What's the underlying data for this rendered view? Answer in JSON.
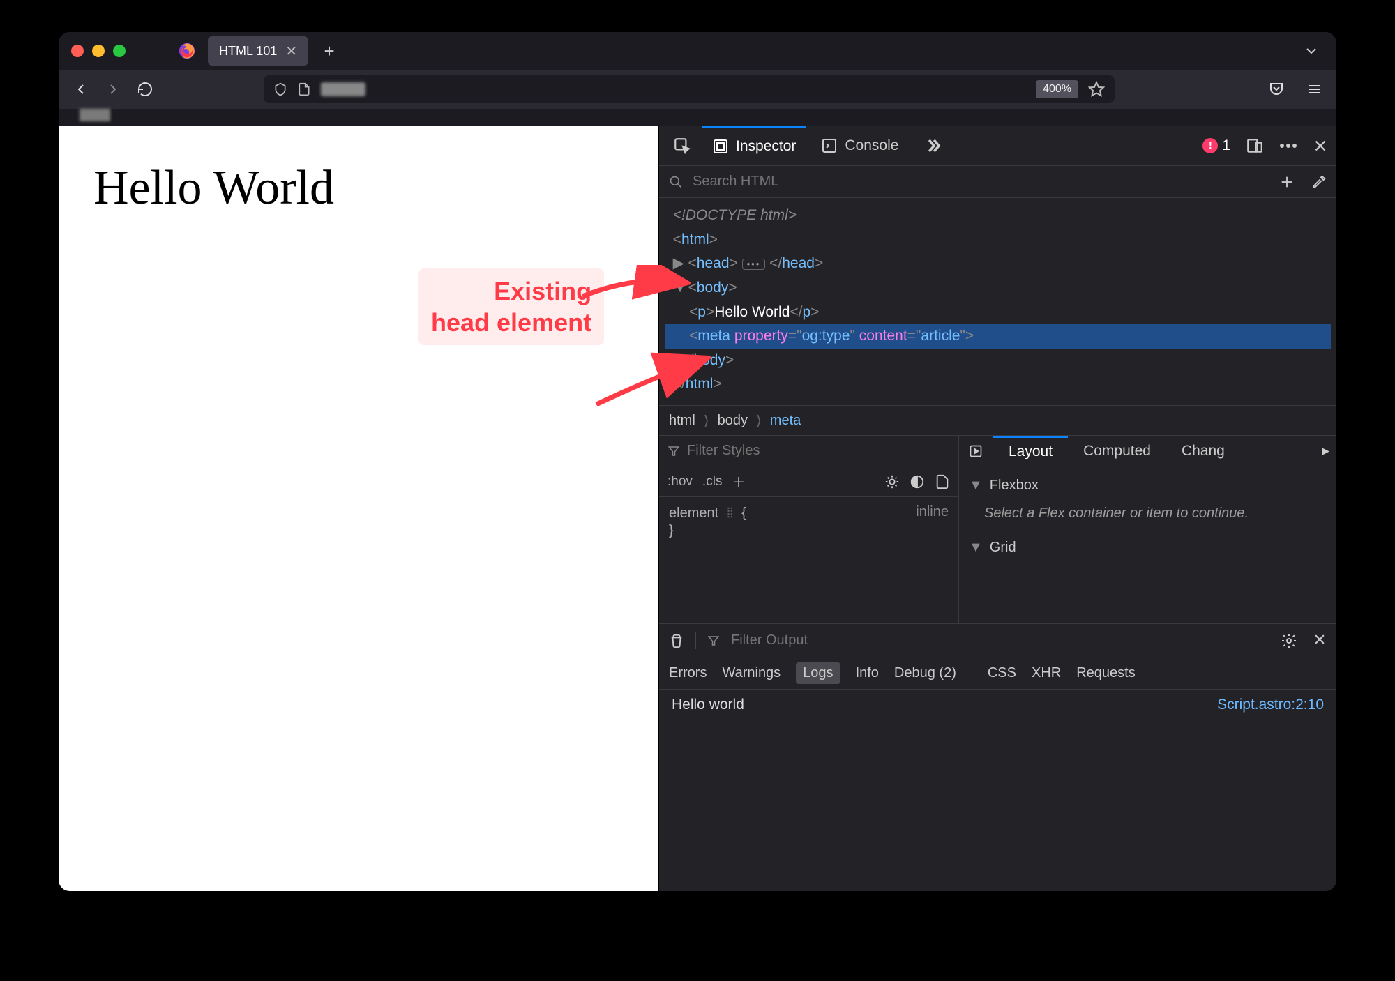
{
  "window": {
    "tab_title": "HTML 101",
    "zoom": "400%"
  },
  "page": {
    "heading": "Hello World"
  },
  "annotation": {
    "line1": "Existing",
    "line2": "head element"
  },
  "devtools": {
    "tabs": {
      "inspector": "Inspector",
      "console": "Console"
    },
    "errors_count": "1",
    "search_placeholder": "Search HTML",
    "dom": {
      "doctype": "<!DOCTYPE html>",
      "html_open": "html",
      "head": "head",
      "body": "body",
      "p_text": "Hello World",
      "meta_attr_prop": "property",
      "meta_attr_prop_v": "og:type",
      "meta_attr_cont": "content",
      "meta_attr_cont_v": "article"
    },
    "breadcrumb": [
      "html",
      "body",
      "meta"
    ],
    "styles": {
      "filter_placeholder": "Filter Styles",
      "hov": ":hov",
      "cls": ".cls",
      "element_label": "element",
      "brace_open": "{",
      "brace_close": "}",
      "inline_label": "inline"
    },
    "layout": {
      "tabs": {
        "layout": "Layout",
        "computed": "Computed",
        "changes": "Chang"
      },
      "flexbox": "Flexbox",
      "flex_msg": "Select a Flex container or item to continue.",
      "grid": "Grid"
    },
    "console": {
      "filter_placeholder": "Filter Output",
      "categories": {
        "errors": "Errors",
        "warnings": "Warnings",
        "logs": "Logs",
        "info": "Info",
        "debug": "Debug (2)",
        "css": "CSS",
        "xhr": "XHR",
        "requests": "Requests"
      },
      "message": "Hello world",
      "source": "Script.astro:2:10"
    }
  }
}
